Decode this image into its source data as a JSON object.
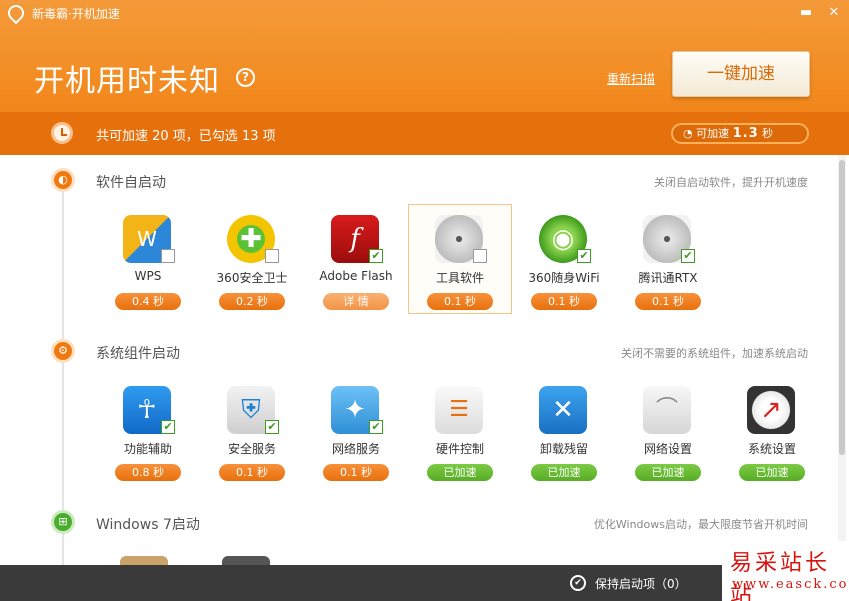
{
  "window": {
    "title": "新毒霸·开机加速",
    "min_glyph": "▬",
    "close_glyph": "✕"
  },
  "header": {
    "title": "开机用时未知",
    "help_glyph": "?",
    "rescan_label": "重新扫描",
    "boost_button": "一键加速",
    "summary": "共可加速 20 项，已勾选 13 项",
    "can_boost_prefix": "可加速",
    "can_boost_value": "1.3",
    "can_boost_unit": "秒"
  },
  "colors": {
    "accent": "#f28a1f",
    "green": "#58ad25"
  },
  "sections": [
    {
      "title": "软件自启动",
      "desc": "关闭自启动软件，提升开机速度",
      "icon": "orange-swirl-icon",
      "items": [
        {
          "label": "WPS",
          "value": "0.4 秒",
          "checked": false,
          "icon": "wps-icon",
          "pill": "orange"
        },
        {
          "label": "360安全卫士",
          "value": "0.2 秒",
          "checked": false,
          "icon": "360-safe-icon",
          "pill": "orange"
        },
        {
          "label": "Adobe Flash",
          "value": "详 情",
          "checked": true,
          "icon": "adobe-flash-icon",
          "pill": "light"
        },
        {
          "label": "工具软件",
          "value": "0.1 秒",
          "checked": false,
          "icon": "disc-icon",
          "pill": "orange",
          "selected": true
        },
        {
          "label": "360随身WiFi",
          "value": "0.1 秒",
          "checked": true,
          "icon": "wifi-icon",
          "pill": "orange"
        },
        {
          "label": "腾讯通RTX",
          "value": "0.1 秒",
          "checked": true,
          "icon": "disc-icon",
          "pill": "orange"
        }
      ]
    },
    {
      "title": "系统组件启动",
      "desc": "关闭不需要的系统组件，加速系统启动",
      "icon": "gear-icon",
      "items": [
        {
          "label": "功能辅助",
          "value": "0.8 秒",
          "checked": true,
          "icon": "accessibility-icon",
          "pill": "orange"
        },
        {
          "label": "安全服务",
          "value": "0.1 秒",
          "checked": true,
          "icon": "security-shield-icon",
          "pill": "orange"
        },
        {
          "label": "网络服务",
          "value": "0.1 秒",
          "checked": true,
          "icon": "network-icon",
          "pill": "orange"
        },
        {
          "label": "硬件控制",
          "value": "已加速",
          "checked": null,
          "icon": "hardware-sliders-icon",
          "pill": "green"
        },
        {
          "label": "卸载残留",
          "value": "已加速",
          "checked": null,
          "icon": "tools-icon",
          "pill": "green"
        },
        {
          "label": "网络设置",
          "value": "已加速",
          "checked": null,
          "icon": "network-chart-icon",
          "pill": "green"
        },
        {
          "label": "系统设置",
          "value": "已加速",
          "checked": null,
          "icon": "gauge-icon",
          "pill": "green"
        }
      ]
    },
    {
      "title": "Windows 7启动",
      "desc": "优化Windows启动，最大限度节省开机时间",
      "icon": "windows-icon"
    }
  ],
  "footer": {
    "keep_label": "保持启动项（0）"
  },
  "watermark": {
    "cn": "易采站长站",
    "url": "www.easck.com"
  }
}
